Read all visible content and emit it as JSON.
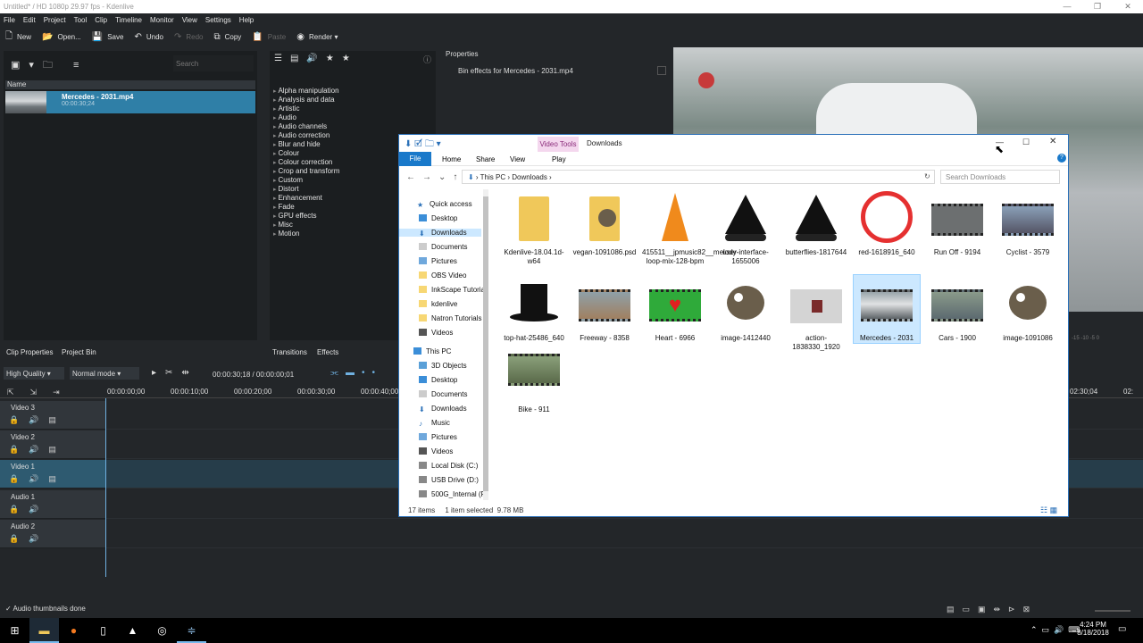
{
  "window": {
    "title": "Untitled* / HD 1080p 29.97 fps - Kdenlive"
  },
  "menu": [
    "File",
    "Edit",
    "Project",
    "Tool",
    "Clip",
    "Timeline",
    "Monitor",
    "View",
    "Settings",
    "Help"
  ],
  "toolbar": {
    "new": "New",
    "open": "Open...",
    "save": "Save",
    "undo": "Undo",
    "redo": "Redo",
    "copy": "Copy",
    "paste": "Paste",
    "render": "Render"
  },
  "bin": {
    "search_placeholder": "Search",
    "col_name": "Name",
    "clip": {
      "name": "Mercedes - 2031.mp4",
      "duration": "00:00:30;24"
    }
  },
  "effects": {
    "categories": [
      "Alpha manipulation",
      "Analysis and data",
      "Artistic",
      "Audio",
      "Audio channels",
      "Audio correction",
      "Blur and hide",
      "Colour",
      "Colour correction",
      "Crop and transform",
      "Custom",
      "Distort",
      "Enhancement",
      "Fade",
      "GPU effects",
      "Misc",
      "Motion"
    ]
  },
  "properties": {
    "title": "Properties",
    "bin_effects": "Bin effects for Mercedes - 2031.mp4"
  },
  "tabs": {
    "clip_properties": "Clip Properties",
    "project_bin": "Project Bin",
    "transitions": "Transitions",
    "effects": "Effects"
  },
  "timeline": {
    "quality": "High Quality",
    "mode": "Normal mode",
    "timecode": "00:00:30;18 / 00:00:00;01",
    "ruler": [
      "00:00:00;00",
      "00:00:10;00",
      "00:00:20;00",
      "00:00:30;00",
      "00:00:40;00"
    ],
    "ruler_right": [
      "02:30;04",
      "02:"
    ],
    "tracks": [
      "Video 3",
      "Video 2",
      "Video 1",
      "Audio 1",
      "Audio 2"
    ]
  },
  "status_msg": "Audio thumbnails done",
  "explorer": {
    "ribbon_context": "Video Tools",
    "title": "Downloads",
    "ribbon_tabs": [
      "File",
      "Home",
      "Share",
      "View",
      "Play"
    ],
    "path": [
      "This PC",
      "Downloads"
    ],
    "search_placeholder": "Search Downloads",
    "nav": [
      "Quick access",
      "Desktop",
      "Downloads",
      "Documents",
      "Pictures",
      "OBS Video",
      "InkScape Tutoria",
      "kdenlive",
      "Natron Tutorials",
      "Videos",
      "This PC",
      "3D Objects",
      "Desktop",
      "Documents",
      "Downloads",
      "Music",
      "Pictures",
      "Videos",
      "Local Disk (C:)",
      "USB Drive (D:)",
      "500G_Internal (F:"
    ],
    "files": [
      {
        "name": "Kdenlive-18.04.1d-w64",
        "icon": "folder-icon"
      },
      {
        "name": "vegan-1091086.psd",
        "icon": "gimp-folder-icon"
      },
      {
        "name": "415511__jpmusic82__melody-loop-mix-128-bpm",
        "icon": "vlc-icon"
      },
      {
        "name": "user-interface-1655006",
        "icon": "inkscape-icon"
      },
      {
        "name": "butterflies-1817644",
        "icon": "inkscape-icon"
      },
      {
        "name": "red-1618916_640",
        "icon": "red-ring-icon"
      },
      {
        "name": "Run Off - 9194",
        "icon": "video-thumb-icon"
      },
      {
        "name": "Cyclist - 3579",
        "icon": "video-thumb-icon"
      },
      {
        "name": "top-hat-25486_640",
        "icon": "top-hat-icon"
      },
      {
        "name": "Freeway - 8358",
        "icon": "video-thumb-icon"
      },
      {
        "name": "Heart - 6966",
        "icon": "heart-video-icon"
      },
      {
        "name": "image-1412440",
        "icon": "gimp-icon"
      },
      {
        "name": "action-1838330_1920",
        "icon": "image-thumb-icon"
      },
      {
        "name": "Mercedes - 2031",
        "icon": "video-thumb-icon"
      },
      {
        "name": "Cars - 1900",
        "icon": "video-thumb-icon"
      },
      {
        "name": "image-1091086",
        "icon": "gimp-icon"
      },
      {
        "name": "Bike - 911",
        "icon": "video-thumb-icon"
      }
    ],
    "status": {
      "count": "17 items",
      "selected": "1 item selected",
      "size": "9.78 MB"
    }
  },
  "clock": {
    "time": "4:24 PM",
    "date": "8/18/2018"
  }
}
